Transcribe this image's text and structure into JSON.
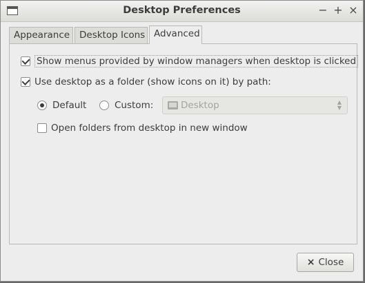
{
  "window": {
    "title": "Desktop Preferences",
    "controls": {
      "minimize": "−",
      "maximize": "+",
      "close": "×"
    }
  },
  "tabs": [
    {
      "label": "Appearance",
      "active": false
    },
    {
      "label": "Desktop Icons",
      "active": false
    },
    {
      "label": "Advanced",
      "active": true
    }
  ],
  "advanced": {
    "show_menus": {
      "label": "Show menus provided by window managers when desktop is clicked",
      "checked": true
    },
    "use_desktop_folder": {
      "label": "Use desktop as a folder (show icons on it) by path:",
      "checked": true
    },
    "path_mode": {
      "default_label": "Default",
      "custom_label": "Custom:",
      "selected": "Default"
    },
    "custom_path_value": "Desktop",
    "open_in_new_window": {
      "label": "Open folders from desktop in new window",
      "checked": false
    }
  },
  "footer": {
    "close_label": "Close",
    "close_icon": "×"
  }
}
